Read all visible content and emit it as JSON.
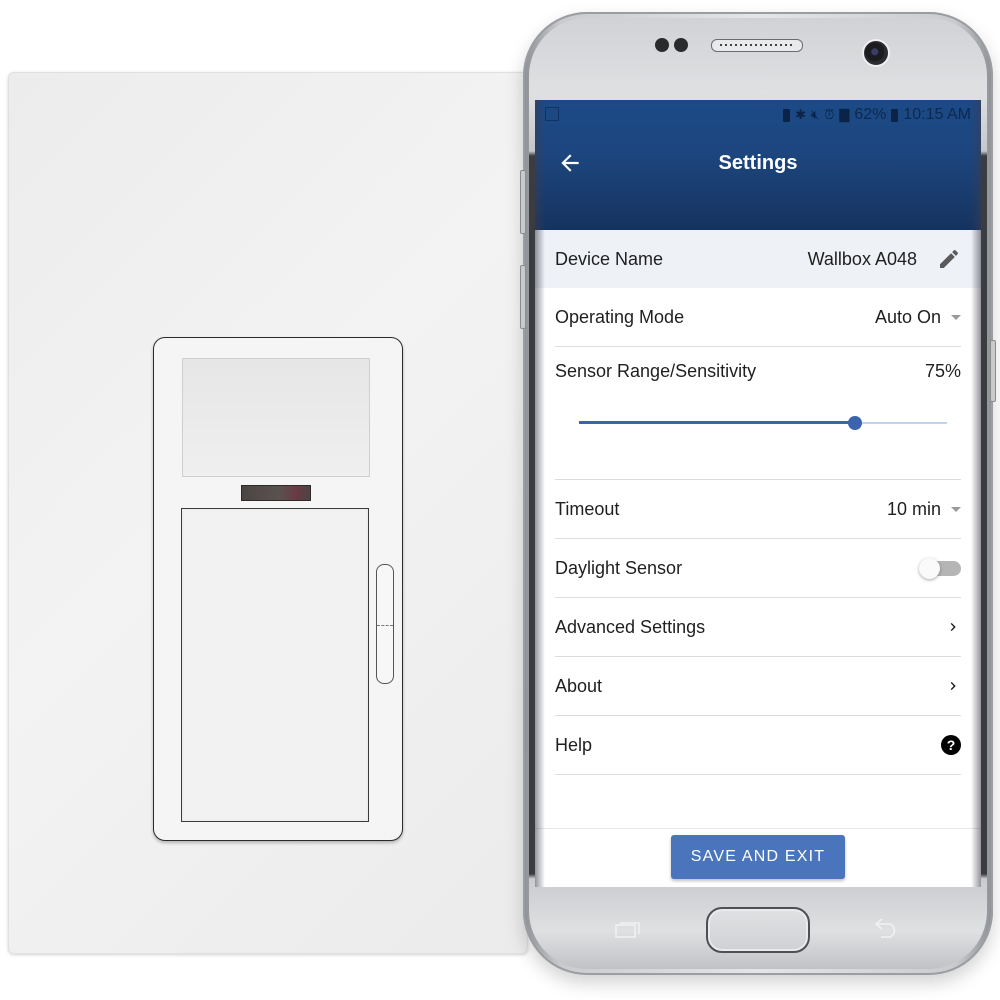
{
  "status_bar": {
    "icons": [
      "notification-icon",
      "battery-saver-icon",
      "bluetooth-icon",
      "mute-icon",
      "alarm-icon",
      "signal-icon",
      "battery-icon"
    ],
    "battery": "62%",
    "time": "10:15 AM"
  },
  "header": {
    "title": "Settings",
    "back_icon": "arrow-left-icon"
  },
  "settings": {
    "device_name": {
      "label": "Device Name",
      "value": "Wallbox A048",
      "icon": "pencil-icon"
    },
    "operating_mode": {
      "label": "Operating Mode",
      "value": "Auto On"
    },
    "sensor_range": {
      "label": "Sensor Range/Sensitivity",
      "value_text": "75%",
      "value": 0.75
    },
    "timeout": {
      "label": "Timeout",
      "value": "10 min"
    },
    "daylight_sensor": {
      "label": "Daylight Sensor",
      "enabled": false
    },
    "advanced_settings": {
      "label": "Advanced Settings",
      "icon": "chevron-right-icon"
    },
    "about": {
      "label": "About",
      "icon": "chevron-right-icon"
    },
    "help": {
      "label": "Help",
      "icon": "help-circle-icon",
      "glyph": "?"
    }
  },
  "footer": {
    "save_label": "SAVE AND EXIT"
  },
  "colors": {
    "header_blue": "#1d467f",
    "accent_blue": "#4a74bb",
    "slider_blue": "#3c63ad"
  }
}
